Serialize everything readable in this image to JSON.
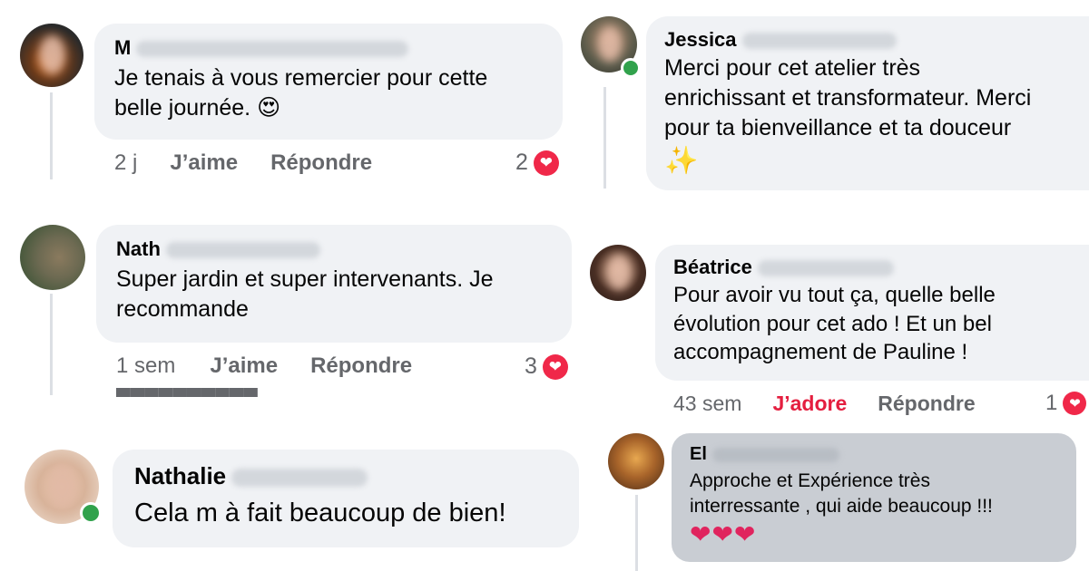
{
  "comments": [
    {
      "author": "M",
      "text_line1": "Je tenais à vous remercier pour cette",
      "text_line2": "belle journée.",
      "emoji": "😍",
      "time": "2 j",
      "like_label": "J’aime",
      "reply_label": "Répondre",
      "reaction_count": "2"
    },
    {
      "author": "Jessica",
      "text_line1": "Merci pour cet atelier très",
      "text_line2": "enrichissant et transformateur. Merci",
      "text_line3": "pour ta bienveillance et ta douceur",
      "emoji": "✨"
    },
    {
      "author": "Nath",
      "text_line1": "Super jardin et super intervenants. Je",
      "text_line2": "recommande",
      "time": "1 sem",
      "like_label": "J’aime",
      "reply_label": "Répondre",
      "reaction_count": "3"
    },
    {
      "author": "Béatrice",
      "text_line1": "Pour avoir vu tout ça, quelle belle",
      "text_line2": "évolution pour cet ado ! Et un bel",
      "text_line3": "accompagnement de Pauline !",
      "time": "43 sem",
      "like_label": "J’adore",
      "reply_label": "Répondre",
      "reaction_count": "1"
    },
    {
      "author": "Nathalie",
      "text_line1": "Cela m à fait beaucoup de bien!"
    },
    {
      "author": "El",
      "text_line1": "Approche et Expérience  très",
      "text_line2": "interressante , qui aide beaucoup !!!",
      "emoji": "❤❤❤"
    }
  ],
  "colors": {
    "bubble": "#f0f2f5",
    "bubble_gray": "#c9cdd3",
    "meta_text": "#65676b",
    "love_red": "#e41e3f",
    "heart_badge": "#f02849",
    "online_green": "#31a24c"
  },
  "icons": [
    "heart-reaction-icon",
    "online-status-dot"
  ]
}
